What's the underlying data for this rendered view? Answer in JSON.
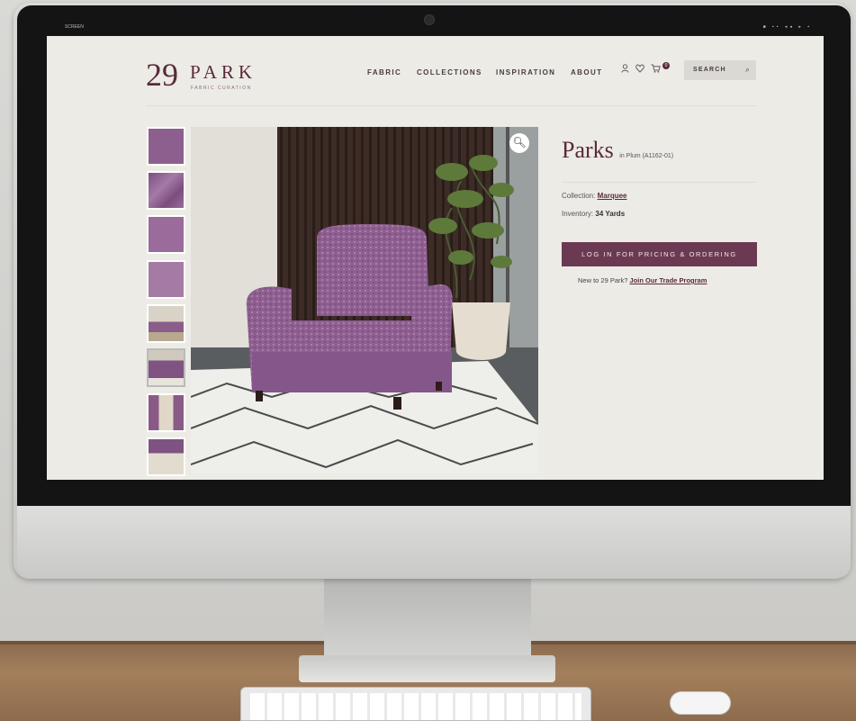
{
  "os_bar": {
    "left_text": "SCREEN",
    "right_text": "■ ▪▪ ◂◂ ▸ ▪"
  },
  "brand": {
    "number": "29",
    "word": "PARK",
    "tagline": "FABRIC CURATION"
  },
  "nav": {
    "items": [
      "FABRIC",
      "COLLECTIONS",
      "INSPIRATION",
      "ABOUT"
    ]
  },
  "header_icons": {
    "account": "user-icon",
    "wishlist": "heart-icon",
    "cart": "cart-icon",
    "cart_count": "0"
  },
  "search": {
    "label": "SEARCH",
    "icon": "search-icon"
  },
  "gallery": {
    "thumbnail_count": 8,
    "zoom_icon": "magnifier-icon"
  },
  "product": {
    "name": "Parks",
    "variant": "in Plum (A1162-01)",
    "collection_label": "Collection:",
    "collection_value": "Marquee",
    "inventory_label": "Inventory:",
    "inventory_value": "34 Yards"
  },
  "cta": {
    "login_label": "LOG IN FOR PRICING & ORDERING",
    "trade_prompt": "New to 29 Park?",
    "trade_link": "Join Our Trade Program"
  },
  "colors": {
    "brand": "#5a2a3c",
    "button": "#6b3a52",
    "page_bg": "#ecebe6",
    "fabric": "#8a5c8c"
  }
}
